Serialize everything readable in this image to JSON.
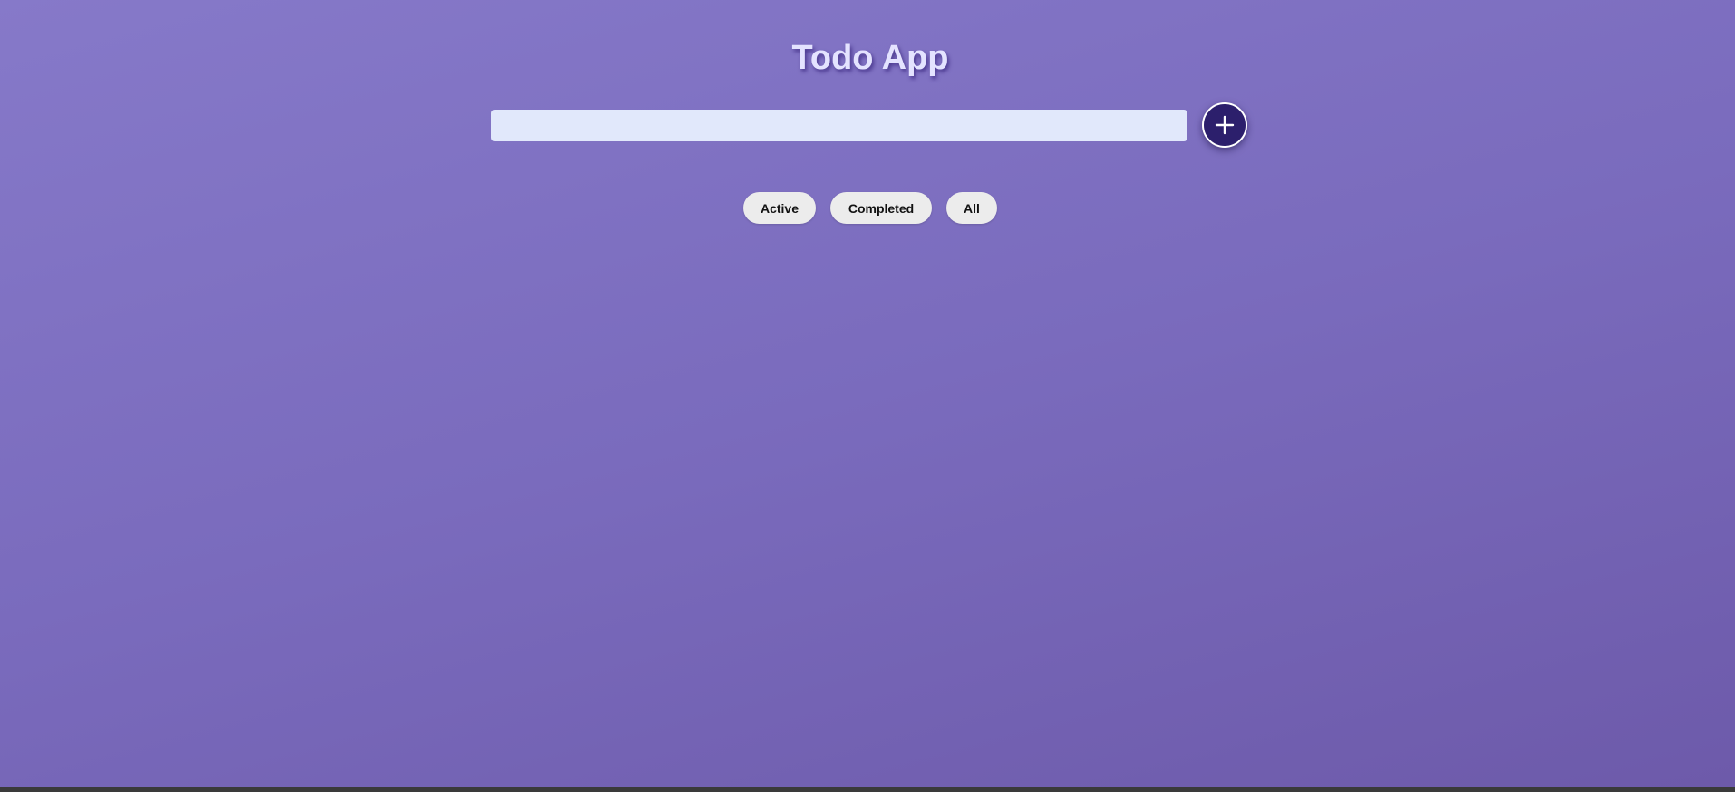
{
  "app": {
    "title": "Todo App"
  },
  "new_task": {
    "value": "",
    "placeholder": "",
    "add_button_icon": "plus-icon"
  },
  "filters": {
    "items": [
      {
        "label": "Active"
      },
      {
        "label": "Completed"
      },
      {
        "label": "All"
      }
    ]
  },
  "colors": {
    "background_top": "#8679c9",
    "background_bottom": "#6d5aaa",
    "title_text": "#e4e3ff",
    "input_background": "#e1e8fb",
    "add_button": "#2c1f6c",
    "filter_button": "#ececec"
  }
}
